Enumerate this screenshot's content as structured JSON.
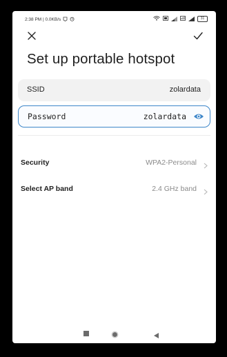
{
  "status_bar": {
    "time_speed": "2:38 PM | 0.0KB/s",
    "battery": "31"
  },
  "screen": {
    "title": "Set up portable hotspot"
  },
  "ssid": {
    "label": "SSID",
    "value": "zolardata"
  },
  "password": {
    "label": "Password",
    "value": "zolardata"
  },
  "security": {
    "label": "Security",
    "value": "WPA2-Personal"
  },
  "ap_band": {
    "label": "Select AP band",
    "value": "2.4 GHz band"
  },
  "colors": {
    "accent": "#3d86c9",
    "field_bg": "#f2f2f2",
    "value_gray": "#8a8a8a"
  },
  "icons": [
    "close-icon",
    "check-icon",
    "eye-icon",
    "chevron-right-icon",
    "recents-icon",
    "home-icon",
    "back-icon",
    "wifi-icon",
    "signal-icon",
    "battery-icon"
  ]
}
